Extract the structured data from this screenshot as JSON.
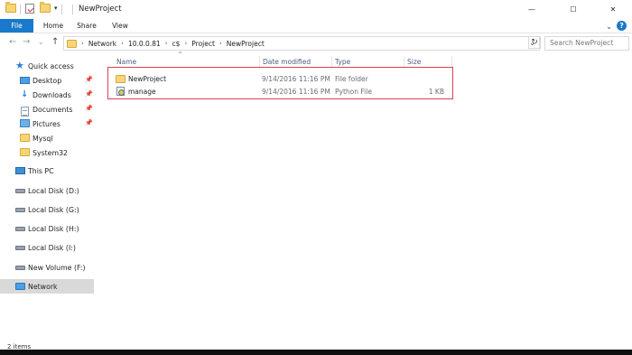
{
  "window": {
    "title": "NewProject",
    "minimize_symbol": "—",
    "maximize_symbol": "☐",
    "close_symbol": "✕"
  },
  "ribbon": {
    "tabs": [
      "File",
      "Home",
      "Share",
      "View"
    ],
    "collapse_symbol": "⌄",
    "help_symbol": "?"
  },
  "nav": {
    "back_symbol": "←",
    "forward_symbol": "→",
    "recent_symbol": "⌄",
    "up_symbol": "↑",
    "breadcrumb": [
      "Network",
      "10.0.0.81",
      "c$",
      "Project",
      "NewProject"
    ],
    "crumb_sep": "›",
    "dropdown_symbol": "⌄",
    "refresh_symbol": "↻",
    "search_placeholder": "Search NewProject"
  },
  "sidebar": {
    "pin_symbol": "📌",
    "items": [
      {
        "label": "Quick access",
        "icon": "star-icon"
      },
      {
        "label": "Desktop",
        "icon": "desktop-icon",
        "pinned": true
      },
      {
        "label": "Downloads",
        "icon": "downloads-icon",
        "pinned": true
      },
      {
        "label": "Documents",
        "icon": "documents-icon",
        "pinned": true
      },
      {
        "label": "Pictures",
        "icon": "pictures-icon",
        "pinned": true
      },
      {
        "label": "Mysql",
        "icon": "folder-icon"
      },
      {
        "label": "System32",
        "icon": "folder-icon"
      },
      {
        "label": "This PC",
        "icon": "this-pc-icon"
      },
      {
        "label": "Local Disk (D:)",
        "icon": "disk-icon"
      },
      {
        "label": "Local Disk (G:)",
        "icon": "disk-icon"
      },
      {
        "label": "Local Disk (H:)",
        "icon": "disk-icon"
      },
      {
        "label": "Local Disk (I:)",
        "icon": "disk-icon"
      },
      {
        "label": "New Volume (F:)",
        "icon": "disk-icon"
      },
      {
        "label": "Network",
        "icon": "network-icon",
        "selected": true
      }
    ]
  },
  "columns": {
    "name": "Name",
    "date": "Date modified",
    "type": "Type",
    "size": "Size",
    "sort_symbol": "^"
  },
  "files": [
    {
      "name": "NewProject",
      "date": "9/14/2016 11:16 PM",
      "type": "File folder",
      "size": "",
      "icon": "folder-icon"
    },
    {
      "name": "manage",
      "date": "9/14/2016 11:16 PM",
      "type": "Python File",
      "size": "1 KB",
      "icon": "python-file-icon"
    }
  ],
  "status": {
    "item_count": "2 items"
  },
  "colors": {
    "file_tab": "#1979ca",
    "selection_outline": "#d9434f",
    "selected_nav": "#d9d9d9"
  }
}
